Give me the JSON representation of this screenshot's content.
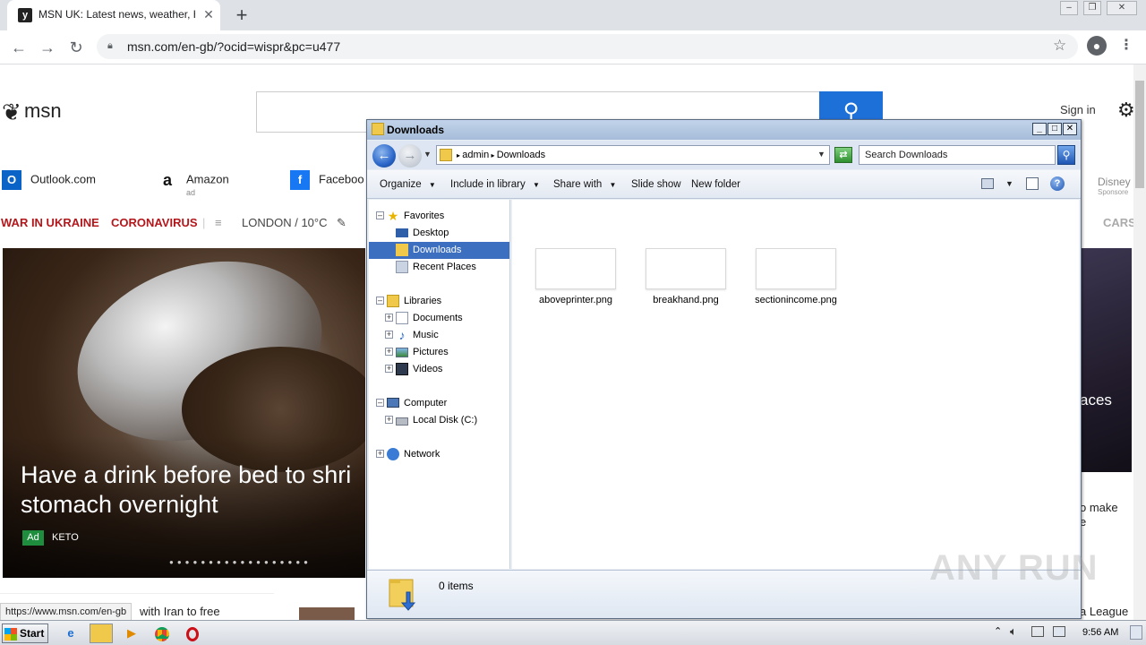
{
  "browser": {
    "tab_title": "MSN UK: Latest news, weather, Hot",
    "url": "msn.com/en-gb/?ocid=wispr&pc=u477",
    "status_url": "https://www.msn.com/en-gb"
  },
  "msn": {
    "logo": "msn",
    "sign_in": "Sign in",
    "quick_links": [
      "Outlook.com",
      "Amazon",
      "Faceboo"
    ],
    "amazon_ad": "ad",
    "nav": [
      "WAR IN UKRAINE",
      "CORONAVIRUS",
      "LONDON / 10°C"
    ],
    "cars": "CARS",
    "disney": "Disney",
    "disney_sponsored": "Sponsore",
    "hero": {
      "title_line1": "Have a drink before bed to shri",
      "title_line2": "stomach overnight",
      "ad_badge": "Ad",
      "sponsor": "KETO"
    },
    "right_hero_text": "aces",
    "right_caption_line1": "o make",
    "right_caption_line2": "e",
    "bottom_headline": "with Iran to free",
    "league_text": "a League"
  },
  "explorer": {
    "title": "Downloads",
    "breadcrumb": [
      "admin",
      "Downloads"
    ],
    "search_placeholder": "Search Downloads",
    "commands": [
      "Organize",
      "Include in library",
      "Share with",
      "Slide show",
      "New folder"
    ],
    "tree": {
      "favorites": "Favorites",
      "desktop": "Desktop",
      "downloads": "Downloads",
      "recent": "Recent Places",
      "libraries": "Libraries",
      "documents": "Documents",
      "music": "Music",
      "pictures": "Pictures",
      "videos": "Videos",
      "computer": "Computer",
      "local_disk": "Local Disk (C:)",
      "network": "Network"
    },
    "files": [
      "aboveprinter.png",
      "breakhand.png",
      "sectionincome.png"
    ],
    "status": "0 items"
  },
  "watermark": "ANY RUN",
  "taskbar": {
    "start": "Start",
    "time": "9:56 AM"
  }
}
